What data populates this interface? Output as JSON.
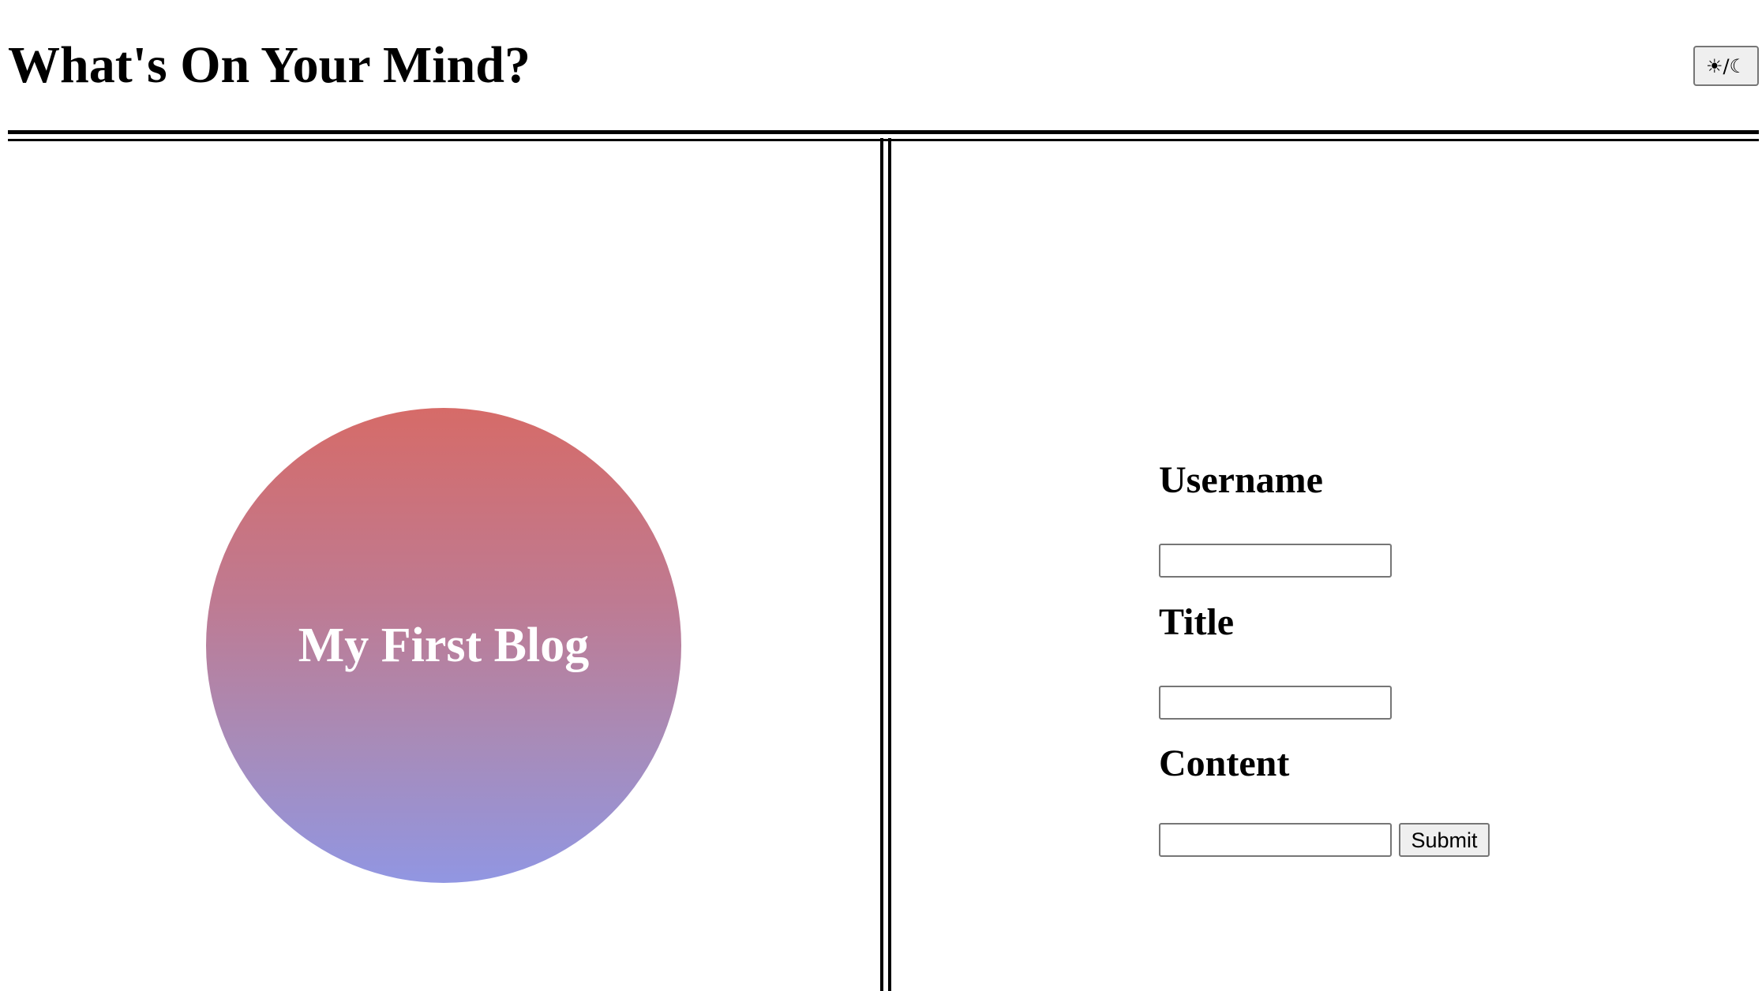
{
  "header": {
    "title": "What's On Your Mind?",
    "theme_toggle_label": "☀/☾"
  },
  "blog": {
    "circle_text": "My First Blog",
    "gradient_colors": [
      "#d66b68",
      "#9196e2"
    ]
  },
  "form": {
    "username_label": "Username",
    "username_value": "",
    "title_label": "Title",
    "title_value": "",
    "content_label": "Content",
    "content_value": "",
    "submit_label": "Submit"
  }
}
